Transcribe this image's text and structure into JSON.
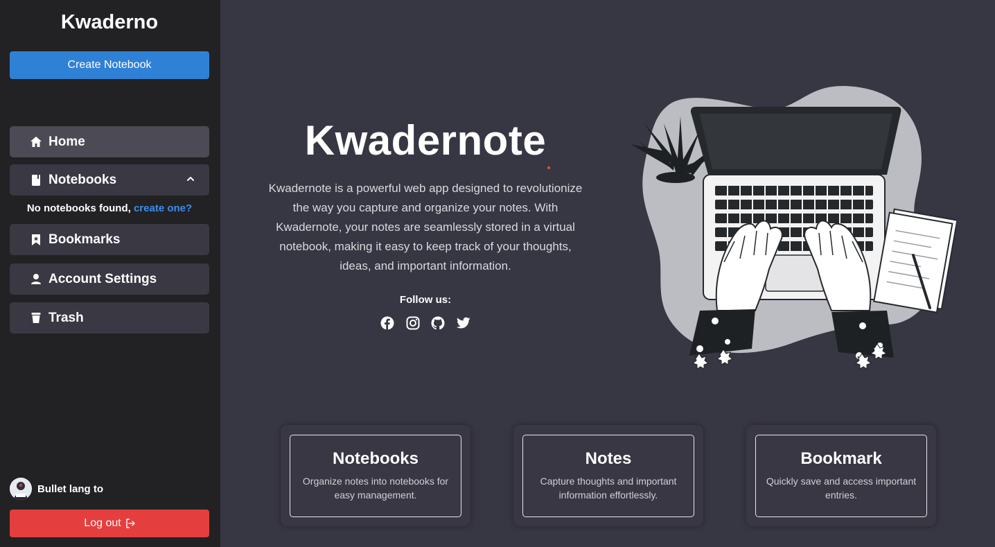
{
  "sidebar": {
    "brand": "Kwaderno",
    "create_button": "Create Notebook",
    "items": [
      {
        "label": "Home",
        "icon": "home-icon",
        "active": true
      },
      {
        "label": "Notebooks",
        "icon": "notebook-icon",
        "expanded": true
      },
      {
        "label": "Bookmarks",
        "icon": "bookmark-icon"
      },
      {
        "label": "Account Settings",
        "icon": "user-icon"
      },
      {
        "label": "Trash",
        "icon": "trash-icon"
      }
    ],
    "notebooks_empty_text": "No notebooks found,",
    "notebooks_empty_link": "create one?",
    "user_name": "Bullet lang to",
    "logout_button": "Log out"
  },
  "hero": {
    "title": "Kwadernote",
    "description": "Kwadernote is a powerful web app designed to revolutionize the way you capture and organize your notes. With Kwadernote, your notes are seamlessly stored in a virtual notebook, making it easy to keep track of your thoughts, ideas, and important information.",
    "follow_label": "Follow us:",
    "socials": [
      "facebook-icon",
      "instagram-icon",
      "github-icon",
      "twitter-icon"
    ]
  },
  "features": [
    {
      "title": "Notebooks",
      "description": "Organize notes into notebooks for easy management."
    },
    {
      "title": "Notes",
      "description": "Capture thoughts and important information effortlessly."
    },
    {
      "title": "Bookmark",
      "description": "Quickly save and access important entries."
    }
  ],
  "colors": {
    "sidebar_bg": "#222224",
    "main_bg": "#373643",
    "primary": "#2f81d6",
    "danger": "#e53e3e",
    "link": "#3b8eea"
  }
}
